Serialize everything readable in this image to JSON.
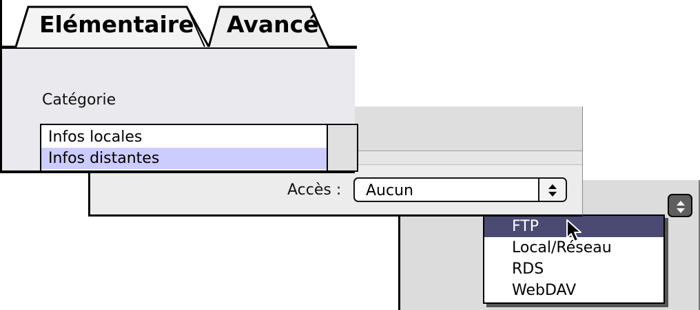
{
  "tabs": [
    {
      "label": "Elémentaire",
      "active": false
    },
    {
      "label": "Avancé",
      "active": true
    }
  ],
  "category": {
    "label": "Catégorie",
    "items": [
      "Infos locales",
      "Infos distantes"
    ],
    "selected": "Infos distantes"
  },
  "access": {
    "label": "Accès :",
    "value": "Aucun"
  },
  "access_menu": {
    "items": [
      "FTP",
      "Local/Réseau",
      "RDS",
      "WebDAV"
    ],
    "highlighted": "FTP"
  },
  "colors": {
    "menu_highlight": "#4a4a72",
    "list_selection": "#ccccff"
  }
}
